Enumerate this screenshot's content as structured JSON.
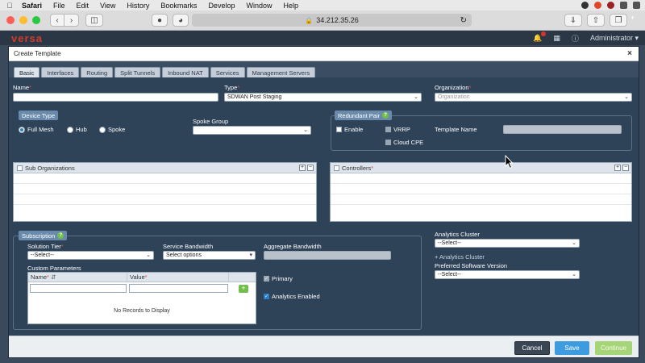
{
  "menubar": {
    "app": "Safari",
    "items": [
      "File",
      "Edit",
      "View",
      "History",
      "Bookmarks",
      "Develop",
      "Window",
      "Help"
    ]
  },
  "browser": {
    "url": "34.212.35.26"
  },
  "app_header": {
    "brand": "versa",
    "user": "Administrator"
  },
  "modal": {
    "title": "Create Template",
    "close_glyph": "×",
    "tabs": [
      "Basic",
      "Interfaces",
      "Routing",
      "Split Tunnels",
      "Inbound NAT",
      "Services",
      "Management Servers"
    ],
    "active_tab": "Basic"
  },
  "form": {
    "name_label": "Name",
    "name_value": "",
    "type_label": "Type",
    "type_value": "SDWAN Post Staging",
    "org_label": "Organization",
    "org_placeholder": "Organization",
    "device_type_title": "Device Type",
    "device_types": [
      "Full Mesh",
      "Hub",
      "Spoke"
    ],
    "device_type_selected": "Full Mesh",
    "spoke_group_label": "Spoke Group",
    "redundant_pair_title": "Redundant Pair",
    "enable_label": "Enable",
    "vrrp_label": "VRRP",
    "cloud_cpe_label": "Cloud CPE",
    "template_name_label": "Template Name",
    "sub_orgs_label": "Sub Organizations",
    "controllers_label": "Controllers",
    "subscription_title": "Subscription",
    "solution_tier_label": "Solution Tier",
    "solution_tier_value": "--Select--",
    "service_bandwidth_label": "Service Bandwidth",
    "service_bandwidth_value": "Select options",
    "aggregate_bandwidth_label": "Aggregate Bandwidth",
    "custom_params_label": "Custom Parameters",
    "col_name": "Name",
    "col_value": "Value",
    "no_records": "No Records to Display",
    "primary_label": "Primary",
    "analytics_enabled_label": "Analytics Enabled",
    "analytics_cluster_label": "Analytics Cluster",
    "analytics_cluster_value": "--Select--",
    "add_analytics_link": "+ Analytics Cluster",
    "pref_sw_label": "Preferred Software Version",
    "pref_sw_value": "--Select--"
  },
  "footer": {
    "cancel": "Cancel",
    "save": "Save",
    "continue": "Continue"
  },
  "colors": {
    "modal_bg": "#2e4258",
    "save": "#3d9be0",
    "continue": "#a6d578",
    "help": "#6fbf4a"
  }
}
